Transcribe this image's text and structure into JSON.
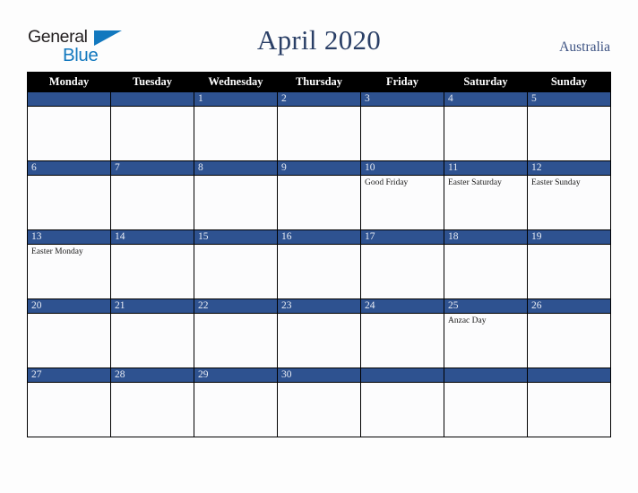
{
  "brand": {
    "word_one": "General",
    "word_two": "Blue",
    "triangle_icon": "triangle-icon",
    "color_dark": "#231f20",
    "color_blue": "#1278be"
  },
  "header": {
    "title": "April 2020",
    "region": "Australia",
    "title_color": "#2a3f66",
    "region_color": "#3c5282"
  },
  "calendar": {
    "accent_color": "#2e5290",
    "header_bg": "#000000",
    "cell_bg": "#fcfcfd",
    "weekday_headers": [
      "Monday",
      "Tuesday",
      "Wednesday",
      "Thursday",
      "Friday",
      "Saturday",
      "Sunday"
    ],
    "weeks": [
      [
        {
          "day": "",
          "events": []
        },
        {
          "day": "",
          "events": []
        },
        {
          "day": "1",
          "events": []
        },
        {
          "day": "2",
          "events": []
        },
        {
          "day": "3",
          "events": []
        },
        {
          "day": "4",
          "events": []
        },
        {
          "day": "5",
          "events": []
        }
      ],
      [
        {
          "day": "6",
          "events": []
        },
        {
          "day": "7",
          "events": []
        },
        {
          "day": "8",
          "events": []
        },
        {
          "day": "9",
          "events": []
        },
        {
          "day": "10",
          "events": [
            "Good Friday"
          ]
        },
        {
          "day": "11",
          "events": [
            "Easter Saturday"
          ]
        },
        {
          "day": "12",
          "events": [
            "Easter Sunday"
          ]
        }
      ],
      [
        {
          "day": "13",
          "events": [
            "Easter Monday"
          ]
        },
        {
          "day": "14",
          "events": []
        },
        {
          "day": "15",
          "events": []
        },
        {
          "day": "16",
          "events": []
        },
        {
          "day": "17",
          "events": []
        },
        {
          "day": "18",
          "events": []
        },
        {
          "day": "19",
          "events": []
        }
      ],
      [
        {
          "day": "20",
          "events": []
        },
        {
          "day": "21",
          "events": []
        },
        {
          "day": "22",
          "events": []
        },
        {
          "day": "23",
          "events": []
        },
        {
          "day": "24",
          "events": []
        },
        {
          "day": "25",
          "events": [
            "Anzac Day"
          ]
        },
        {
          "day": "26",
          "events": []
        }
      ],
      [
        {
          "day": "27",
          "events": []
        },
        {
          "day": "28",
          "events": []
        },
        {
          "day": "29",
          "events": []
        },
        {
          "day": "30",
          "events": []
        },
        {
          "day": "",
          "events": []
        },
        {
          "day": "",
          "events": []
        },
        {
          "day": "",
          "events": []
        }
      ]
    ]
  }
}
